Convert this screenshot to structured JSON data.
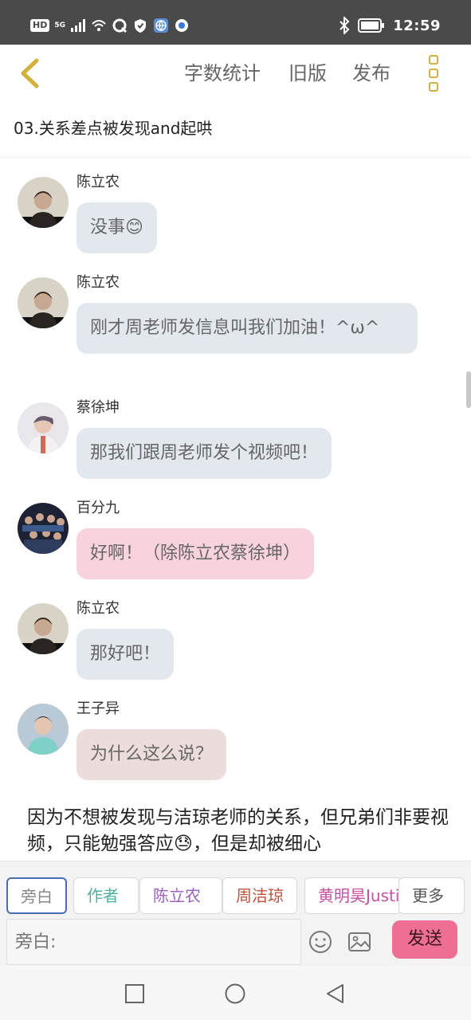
{
  "status_bar": {
    "hd_label": "HD",
    "network_label": "5G",
    "time": "12:59"
  },
  "toolbar": {
    "word_count_label": "字数统计",
    "old_version_label": "旧版",
    "publish_label": "发布"
  },
  "chapter_title": "03.关系差点被发现and起哄",
  "messages": [
    {
      "sender": "陈立农",
      "text": "没事😊",
      "bubble_color": "#e3e8ef"
    },
    {
      "sender": "陈立农",
      "text": "刚才周老师发信息叫我们加油！^ω^",
      "bubble_color": "#e3e8ef"
    },
    {
      "sender": "蔡徐坤",
      "text": "那我们跟周老师发个视频吧！",
      "bubble_color": "#e3e8ef"
    },
    {
      "sender": "百分九",
      "text": "好啊！（除陈立农蔡徐坤）",
      "bubble_color": "#f8d3de"
    },
    {
      "sender": "陈立农",
      "text": "那好吧！",
      "bubble_color": "#e3e8ef"
    },
    {
      "sender": "王子异",
      "text": "为什么这么说？",
      "bubble_color": "#eddcdc"
    }
  ],
  "narration": "因为不想被发现与洁琼老师的关系，但兄弟们非要视频，只能勉强答应😓，但是却被细心",
  "roles": {
    "narrator": "旁白",
    "author": "作者",
    "chen": "陈立农",
    "zhou": "周洁琼",
    "huang": "黄明昊Justin",
    "more": "更多"
  },
  "input": {
    "placeholder": "旁白:"
  },
  "send_label": "发送",
  "colors": {
    "status_bar_bg": "#4a4a4a",
    "accent_gold": "#d4b13a",
    "send_button": "#ef6e94",
    "selected_role_border": "#4a6cb5"
  }
}
